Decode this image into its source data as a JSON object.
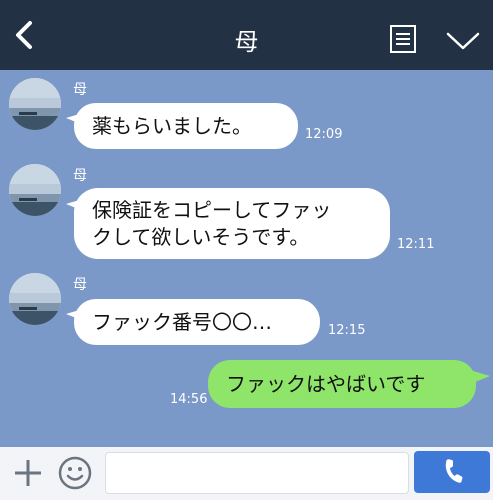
{
  "header": {
    "title": "母"
  },
  "messages": [
    {
      "sender": "母",
      "text": "薬もらいました。",
      "time": "12:09"
    },
    {
      "sender": "母",
      "line1": "保険証をコピーしてファッ",
      "line2": "クして欲しいそうです。",
      "time": "12:11"
    },
    {
      "sender": "母",
      "text": "ファック番号〇〇…",
      "time": "12:15"
    },
    {
      "sender": "me",
      "text": "ファックはやばいです",
      "time": "14:56"
    }
  ],
  "input": {
    "placeholder": ""
  },
  "icons": {
    "back": "chevron-left-icon",
    "menu": "document-list-icon",
    "expand": "chevron-down-icon",
    "add": "plus-icon",
    "emoji": "smiley-icon",
    "call": "phone-icon"
  },
  "colors": {
    "header": "#223144",
    "background": "#7a98c8",
    "incoming_bubble": "#ffffff",
    "outgoing_bubble": "#8ee56a",
    "call_button": "#3e79d8"
  }
}
